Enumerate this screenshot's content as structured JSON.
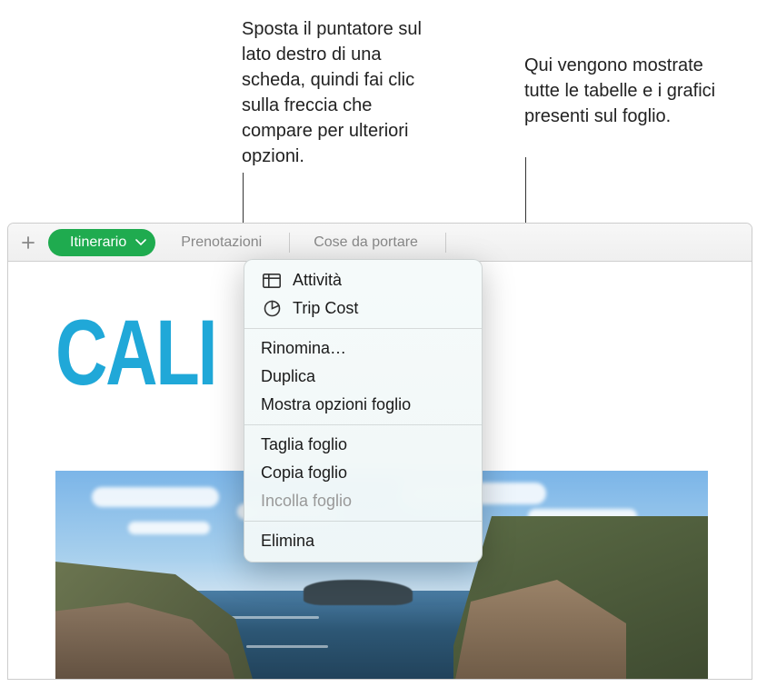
{
  "callouts": {
    "left": "Sposta il puntatore sul lato destro di una scheda, quindi fai clic sulla freccia che compare per ulteriori opzioni.",
    "right": "Qui vengono mostrate tutte le tabelle e i grafici presenti sul foglio."
  },
  "tabs": {
    "active": "Itinerario",
    "second": "Prenotazioni",
    "third": "Cose da portare"
  },
  "big_title": "CALI",
  "menu": {
    "table_item": "Attività",
    "chart_item": "Trip Cost",
    "rename": "Rinomina…",
    "duplicate": "Duplica",
    "show_options": "Mostra opzioni foglio",
    "cut": "Taglia foglio",
    "copy": "Copia foglio",
    "paste": "Incolla foglio",
    "delete": "Elimina"
  }
}
